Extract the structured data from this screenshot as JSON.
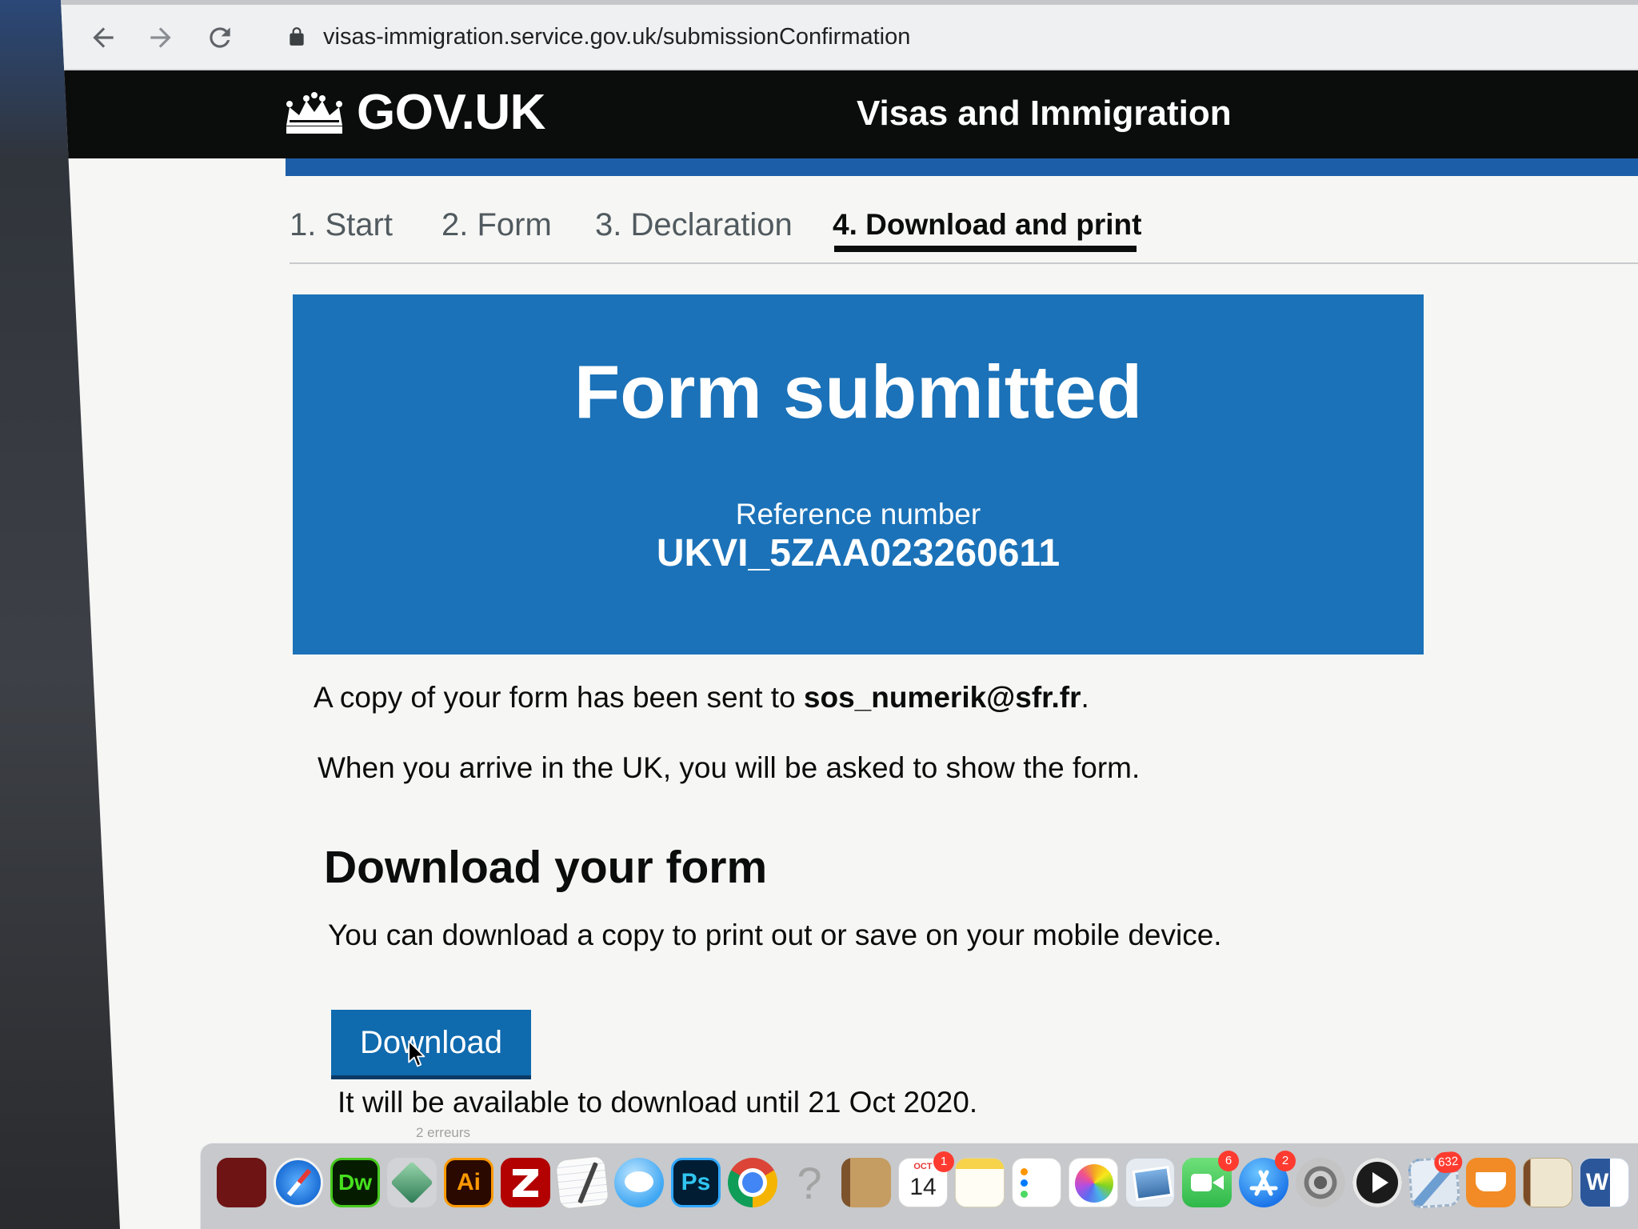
{
  "browser": {
    "url": "visas-immigration.service.gov.uk/submissionConfirmation",
    "icons": {
      "back": "back-arrow-icon",
      "forward": "forward-arrow-icon",
      "reload": "reload-icon",
      "secure": "lock-icon"
    }
  },
  "header": {
    "logo_icon": "crown-icon",
    "logo_text": "GOV.UK",
    "service_name": "Visas and Immigration"
  },
  "steps": [
    {
      "label": "1. Start",
      "active": false
    },
    {
      "label": "2. Form",
      "active": false
    },
    {
      "label": "3. Declaration",
      "active": false
    },
    {
      "label": "4. Download and print",
      "active": true
    }
  ],
  "panel": {
    "title": "Form submitted",
    "reference_label": "Reference number",
    "reference_number": "UKVI_5ZAA023260611"
  },
  "body": {
    "copy_sent_prefix": "A copy of your form has been sent to ",
    "email": "sos_numerik@sfr.fr",
    "copy_sent_suffix": ".",
    "arrival_note": "When you arrive in the UK, you will be asked to show the form.",
    "download_heading": "Download your form",
    "download_intro": "You can download a copy to print out or save on your mobile device.",
    "download_button": "Download",
    "availability": "It will be available to download until 21 Oct 2020."
  },
  "background_window": {
    "status": "2 erreurs"
  },
  "dock": {
    "apps": [
      {
        "icon": "red-app-icon"
      },
      {
        "icon": "safari-icon"
      },
      {
        "icon": "dreamweaver-icon",
        "label": "Dw"
      },
      {
        "icon": "sourcetree-icon"
      },
      {
        "icon": "illustrator-icon",
        "label": "Ai"
      },
      {
        "icon": "filezilla-icon"
      },
      {
        "icon": "textedit-icon"
      },
      {
        "icon": "messages-icon"
      },
      {
        "icon": "photoshop-icon",
        "label": "Ps"
      },
      {
        "icon": "chrome-icon"
      },
      {
        "icon": "help-icon",
        "label": "?"
      },
      {
        "icon": "contacts-icon"
      },
      {
        "icon": "calendar-icon",
        "month": "OCT",
        "day": "14",
        "badge": "1"
      },
      {
        "icon": "notes-icon"
      },
      {
        "icon": "reminders-icon"
      },
      {
        "icon": "photos-icon"
      },
      {
        "icon": "preview-icon"
      },
      {
        "icon": "facetime-icon",
        "badge": "6"
      },
      {
        "icon": "app-store-icon",
        "badge": "2"
      },
      {
        "icon": "system-preferences-icon"
      },
      {
        "icon": "quicktime-icon"
      },
      {
        "icon": "mail-icon",
        "badge": "632"
      },
      {
        "icon": "ibooks-icon"
      },
      {
        "icon": "notebook-icon"
      },
      {
        "icon": "word-icon",
        "label": "W"
      }
    ]
  },
  "colors": {
    "govuk_black": "#0b0c0c",
    "service_stripe": "#1d5ea8",
    "panel_blue": "#1b72b8",
    "button_blue": "#0f6aae",
    "step_inactive": "#505a5f"
  }
}
